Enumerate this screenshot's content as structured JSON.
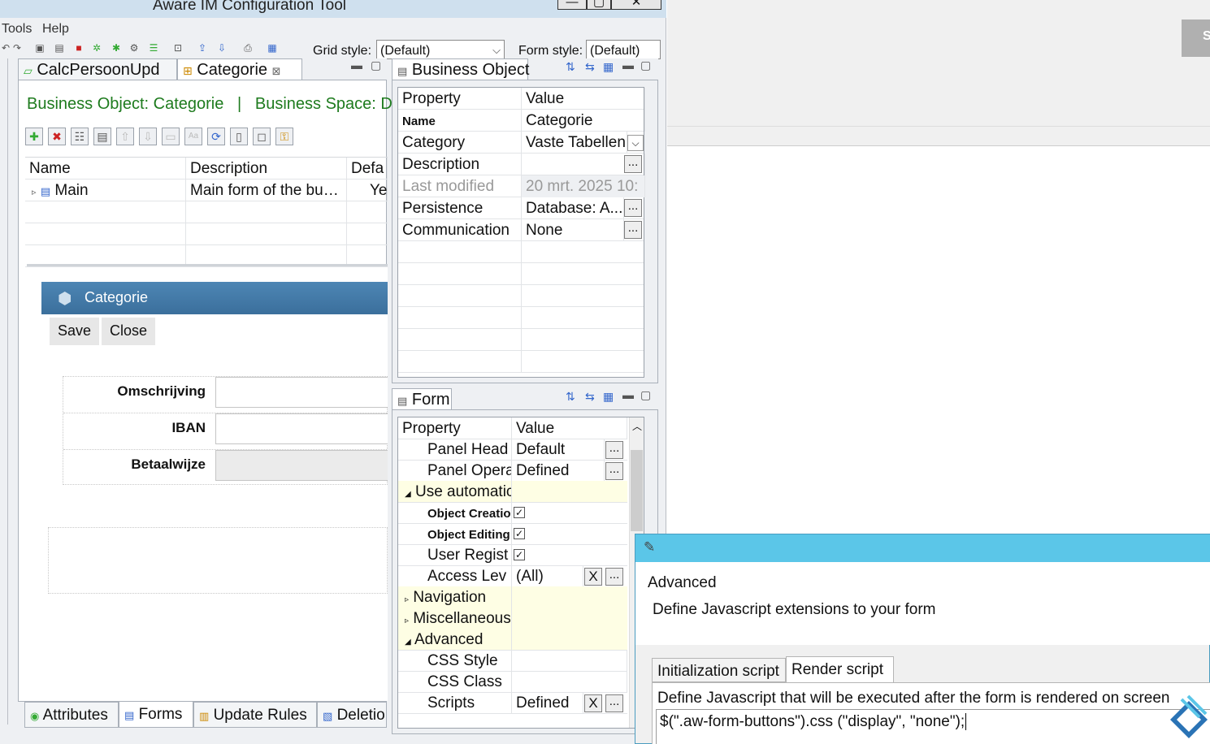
{
  "app": {
    "title": "Aware IM Configuration Tool"
  },
  "menu": {
    "tools": "Tools",
    "help": "Help"
  },
  "toolbar": {
    "grid_style_label": "Grid style:",
    "grid_style_value": "(Default)",
    "form_style_label": "Form style:",
    "form_style_value": "(Default)"
  },
  "editor": {
    "tabs": [
      "CalcPersoonUpd",
      "Categorie"
    ],
    "header": "Business Object: Categorie   |   Business Space: D",
    "columns": [
      "Name",
      "Description",
      "Defa"
    ],
    "rows": [
      {
        "name": "Main",
        "description": "Main form of the bu…",
        "default": "Ye"
      }
    ],
    "preview": {
      "title": "Categorie",
      "save": "Save",
      "close": "Close",
      "fields": [
        "Omschrijving",
        "IBAN",
        "Betaalwijze"
      ]
    },
    "bottom_tabs": [
      "Attributes",
      "Forms",
      "Update Rules",
      "Deletio"
    ]
  },
  "bo_panel": {
    "title": "Business Object",
    "columns": [
      "Property",
      "Value"
    ],
    "rows": [
      {
        "property": "Name",
        "value": "Categorie"
      },
      {
        "property": "Category",
        "value": "Vaste Tabellen"
      },
      {
        "property": "Description",
        "value": ""
      },
      {
        "property": "Last modified",
        "value": "20 mrt. 2025 10:"
      },
      {
        "property": "Persistence",
        "value": "Database: A..."
      },
      {
        "property": "Communication",
        "value": "None"
      }
    ]
  },
  "form_panel": {
    "title": "Form",
    "columns": [
      "Property",
      "Value"
    ],
    "rows": [
      {
        "property": "Panel Head",
        "value": "Default"
      },
      {
        "property": "Panel Opera",
        "value": "Defined"
      },
      {
        "property": "Use automatic",
        "value": ""
      },
      {
        "property": "Object Creation",
        "value": ""
      },
      {
        "property": "Object Editing",
        "value": ""
      },
      {
        "property": "User Regist",
        "value": ""
      },
      {
        "property": "Access Lev",
        "value": "(All)"
      },
      {
        "property": "Navigation",
        "value": ""
      },
      {
        "property": "Miscellaneous",
        "value": ""
      },
      {
        "property": "Advanced",
        "value": ""
      },
      {
        "property": "CSS Style",
        "value": ""
      },
      {
        "property": "CSS Class",
        "value": ""
      },
      {
        "property": "Scripts",
        "value": "Defined"
      }
    ],
    "x_label": "X",
    "dots_label": "..."
  },
  "dialog": {
    "heading": "Advanced",
    "subheading": "Define Javascript extensions to your form",
    "tabs": [
      "Initialization script",
      "Render script"
    ],
    "description": "Define Javascript that will be executed after the form is rendered on screen",
    "code": "$(\".aw-form-buttons\").css (\"display\", \"none\");"
  },
  "side_button": {
    "label": "S"
  }
}
